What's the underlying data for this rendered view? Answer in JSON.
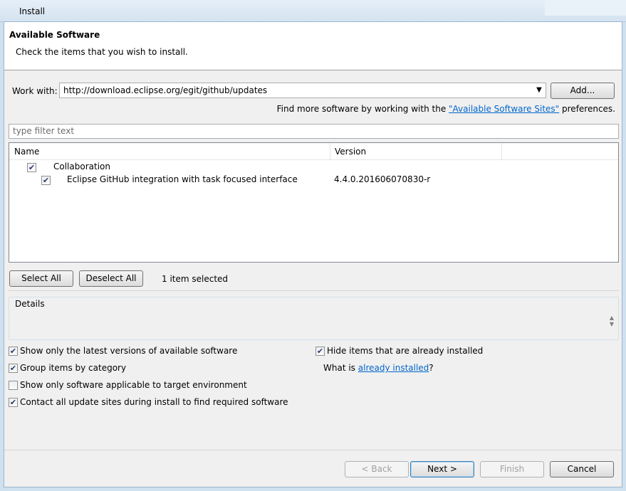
{
  "window": {
    "title": "Install"
  },
  "header": {
    "title": "Available Software",
    "description": "Check the items that you wish to install."
  },
  "work_with": {
    "label": "Work with:",
    "value": "http://download.eclipse.org/egit/github/updates",
    "add_label": "Add...",
    "find_more_prefix": "Find more software by working with the ",
    "find_more_link": "\"Available Software Sites\"",
    "find_more_suffix": " preferences."
  },
  "filter": {
    "placeholder": "type filter text"
  },
  "tree": {
    "columns": [
      "Name",
      "Version"
    ],
    "rows": [
      {
        "name": "Collaboration",
        "version": "",
        "checked": true
      },
      {
        "name": "Eclipse GitHub integration with task focused interface",
        "version": "4.4.0.201606070830-r",
        "checked": true
      }
    ]
  },
  "selection": {
    "select_all": "Select All",
    "deselect_all": "Deselect All",
    "status": "1 item selected"
  },
  "details": {
    "label": "Details"
  },
  "options": {
    "latest_versions": "Show only the latest versions of available software",
    "group_by_category": "Group items by category",
    "applicable_only": "Show only software applicable to target environment",
    "contact_all_sites": "Contact all update sites during install to find required software",
    "hide_installed": "Hide items that are already installed",
    "what_is_prefix": "What is ",
    "what_is_link": "already installed",
    "what_is_suffix": "?",
    "states": {
      "latest_versions": true,
      "group_by_category": true,
      "applicable_only": false,
      "contact_all_sites": true,
      "hide_installed": true
    }
  },
  "footer": {
    "back": "< Back",
    "next": "Next >",
    "finish": "Finish",
    "cancel": "Cancel"
  },
  "icons": {
    "check": "checkmark-icon",
    "dropdown": "dropdown-arrow-icon"
  }
}
